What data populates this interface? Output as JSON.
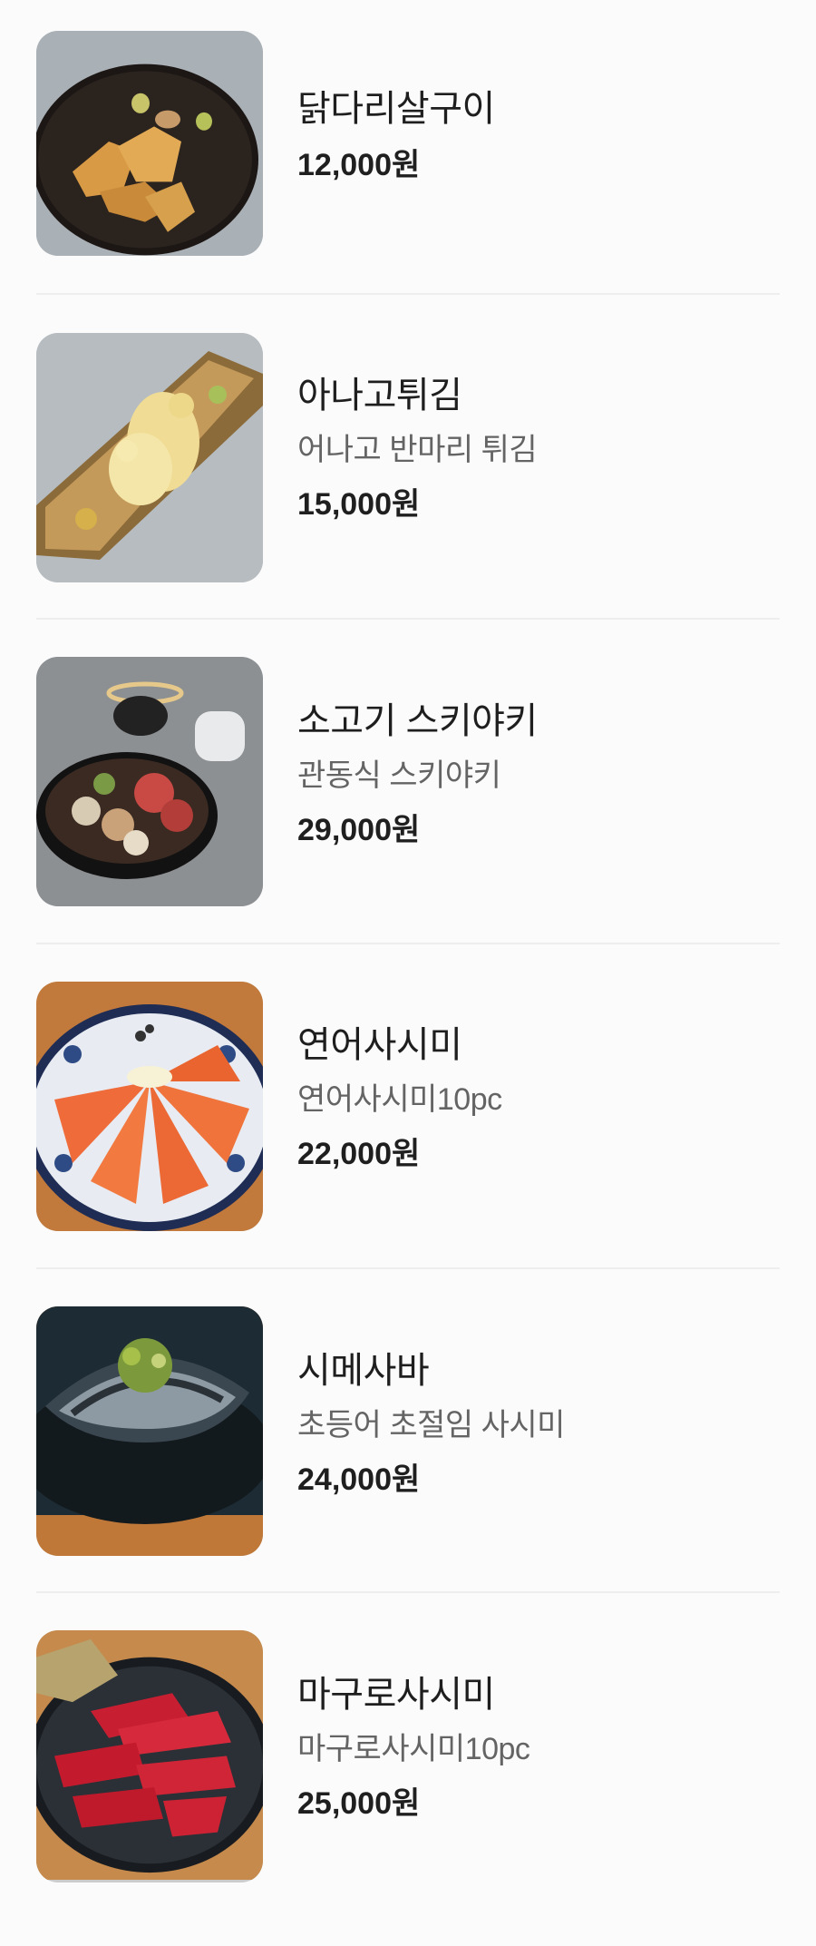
{
  "menu": {
    "items": [
      {
        "name": "닭다리살구이",
        "description": "",
        "price": "12,000원"
      },
      {
        "name": "아나고튀김",
        "description": "어나고 반마리 튀김",
        "price": "15,000원"
      },
      {
        "name": "소고기 스키야키",
        "description": "관동식 스키야키",
        "price": "29,000원"
      },
      {
        "name": "연어사시미",
        "description": "연어사시미10pc",
        "price": "22,000원"
      },
      {
        "name": "시메사바",
        "description": "초등어 초절임 사시미",
        "price": "24,000원"
      },
      {
        "name": "마구로사시미",
        "description": "마구로사시미10pc",
        "price": "25,000원"
      }
    ]
  }
}
